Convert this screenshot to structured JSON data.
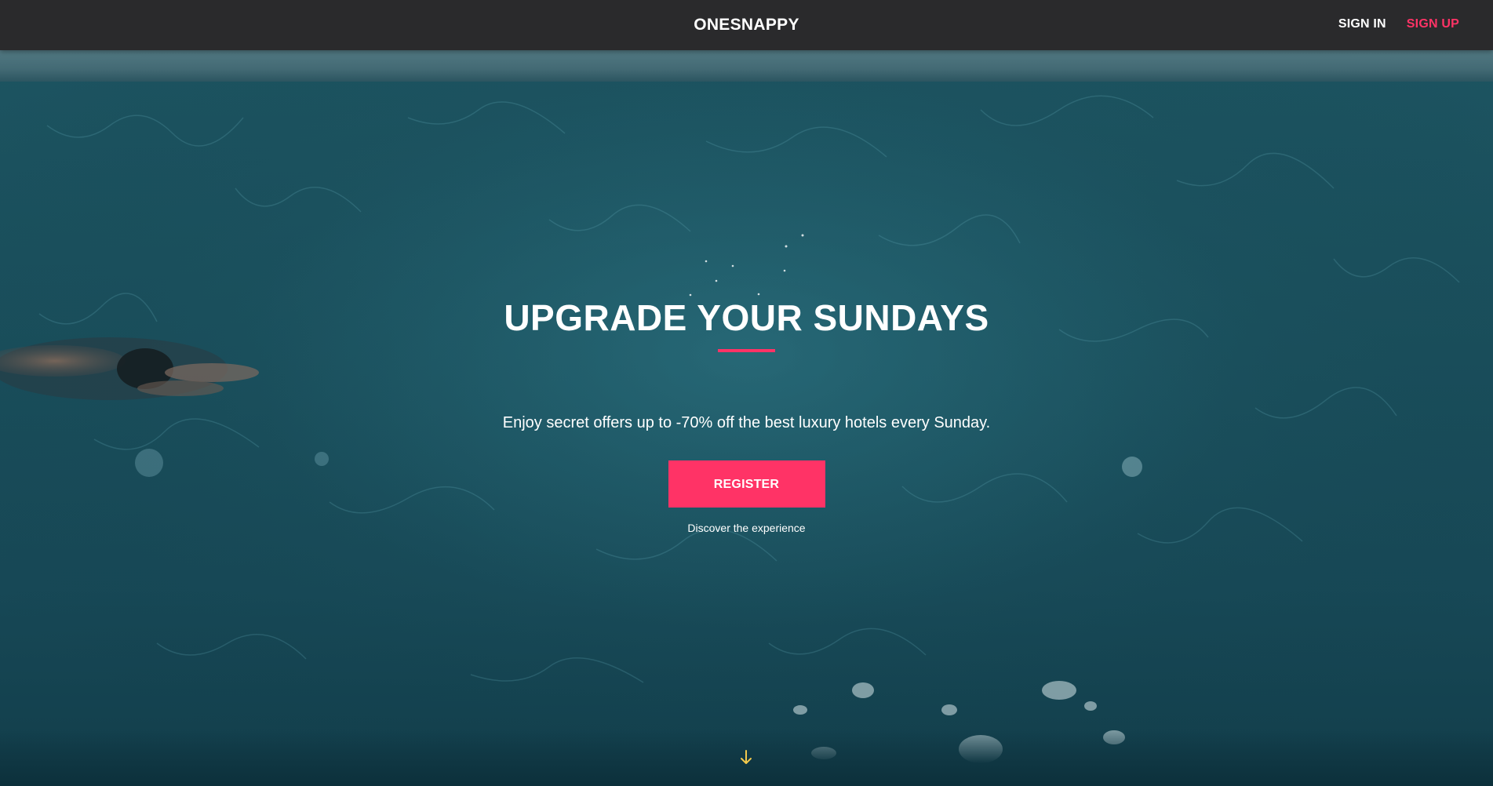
{
  "navbar": {
    "brand": "ONESNAPPY",
    "sign_in": "SIGN IN",
    "sign_up": "SIGN UP"
  },
  "hero": {
    "title": "UPGRADE YOUR SUNDAYS",
    "subtitle": "Enjoy secret offers up to -70% off the best luxury hotels every Sunday.",
    "register_label": "REGISTER",
    "discover_label": "Discover the experience",
    "scroll_icon": "arrow-down-icon",
    "background_image": "aerial view of a swimmer in a blue pool"
  },
  "colors": {
    "accent": "#ff3366",
    "navbar_bg": "#2a2a2c",
    "text": "#ffffff",
    "arrow": "#f2c94c"
  }
}
